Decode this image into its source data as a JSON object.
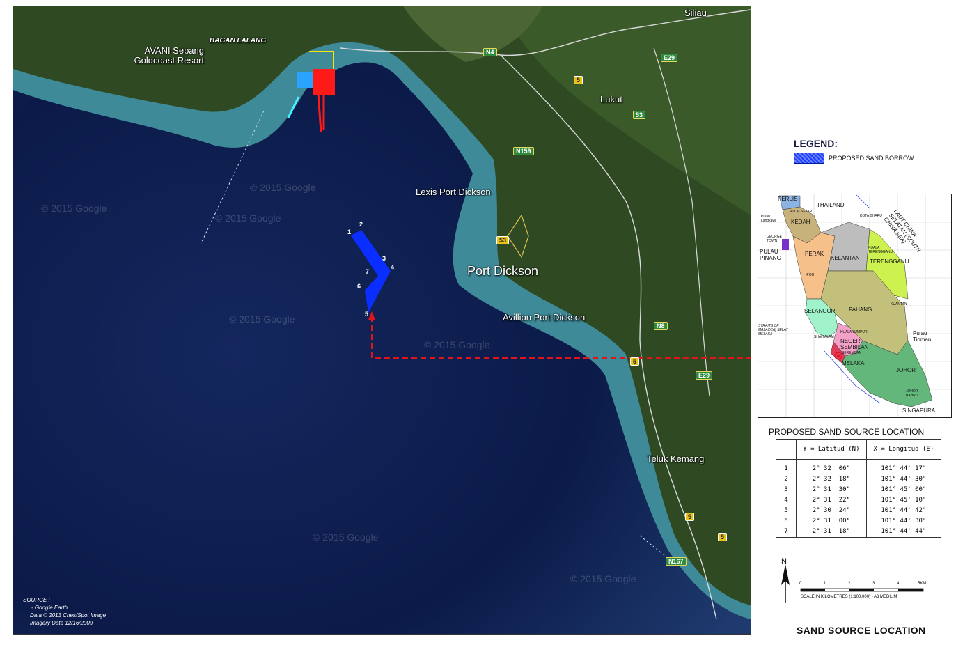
{
  "map": {
    "places": [
      {
        "name": "Siliau"
      },
      {
        "name": "BAGAN LALANG"
      },
      {
        "name": "AVANI Sepang Goldcoast Resort"
      },
      {
        "name": "Lukut"
      },
      {
        "name": "Lexis Port Dickson"
      },
      {
        "name": "Port Dickson"
      },
      {
        "name": "Avillion Port Dickson"
      },
      {
        "name": "Teluk Kemang"
      }
    ],
    "roads": [
      "N4",
      "E29",
      "5",
      "53",
      "N159",
      "53",
      "N8",
      "5",
      "E29",
      "5",
      "5",
      "N167"
    ],
    "watermark": "© 2015 Google",
    "sand_borrow_points": [
      "1",
      "2",
      "3",
      "4",
      "5",
      "6",
      "7"
    ],
    "colors": {
      "sand_borrow": "#0a2eff",
      "leader_line": "#e0151b",
      "sea_deep": "#0b1a48",
      "sea_shallow": "#3f8a98",
      "land": "#2f4a22"
    }
  },
  "source": {
    "heading": "SOURCE :",
    "line1": "- Google Earth",
    "line2": "Data © 2013 Cnes/Spot Image",
    "line3": "Imagery Date 12/16/2009"
  },
  "legend": {
    "title": "LEGEND:",
    "item": "PROPOSED SAND BORROW",
    "swatch_icon": "blue-hatch-swatch"
  },
  "inset": {
    "labels": {
      "perlis": "PERLIS",
      "thailand": "THAILAND",
      "alor_setar": "ALOR SETAR",
      "kota_bharu": "KOTA BHARU",
      "pulau_langkawi": "Pulau Langkawi",
      "kedah": "KEDAH",
      "laut": "LAUT CHINA SELATAN (SOUTH CHINA SEA)",
      "george_town": "GEORGE TOWN",
      "kuala_terengganu": "KUALA TERENGGANU",
      "pulau_pinang": "PULAU PINANG",
      "perak": "PERAK",
      "kelantan": "KELANTAN",
      "terengganu": "TERENGGANU",
      "ipoh": "IPOH",
      "kuantan": "KUANTAN",
      "selangor": "SELANGOR",
      "pahang": "PAHANG",
      "straits": "STRAITS OF MALACCA) SELAT MELAKA",
      "kuala_lumpur": "KUALA LUMPUR",
      "shah_alam": "SHAH ALAM",
      "negeri": "NEGERI SEMBILAN",
      "seremban": "SEREMBAN",
      "pulau_tioman": "Pulau Tioman",
      "melaka": "MELAKA",
      "johor": "JOHOR",
      "johor_bahru": "JOHOR BAHRU",
      "singapura": "SINGAPURA"
    },
    "colors": {
      "perlis": "#8db3e2",
      "kedah": "#c8b27c",
      "pulau_pinang": "#7a30c8",
      "perak": "#f6c08b",
      "kelantan": "#bdbdbd",
      "terengganu": "#cdf24f",
      "pahang": "#c2c07a",
      "selangor": "#9ff2ca",
      "negeri": "#f4a1c7",
      "melaka": "#e03b5a",
      "johor": "#64b77a"
    }
  },
  "coordinates": {
    "title": "PROPOSED SAND SOURCE LOCATION",
    "headers": [
      "",
      "Y = Latitud (N)",
      "X = Longitud (E)"
    ],
    "rows": [
      {
        "id": "1",
        "lat": "2°  32' 06\"",
        "lon": "101°  44' 17\""
      },
      {
        "id": "2",
        "lat": "2°  32' 18\"",
        "lon": "101°  44' 30\""
      },
      {
        "id": "3",
        "lat": "2°  31' 30\"",
        "lon": "101°  45' 00\""
      },
      {
        "id": "4",
        "lat": "2°  31' 22\"",
        "lon": "101°  45' 10\""
      },
      {
        "id": "5",
        "lat": "2°  30' 24\"",
        "lon": "101°  44' 42\""
      },
      {
        "id": "6",
        "lat": "2°  31' 00\"",
        "lon": "101°  44' 30\""
      },
      {
        "id": "7",
        "lat": "2°  31' 18\"",
        "lon": "101°  44' 44\""
      }
    ]
  },
  "scale": {
    "north": "N",
    "ticks": [
      "0",
      "1",
      "2",
      "3",
      "4",
      "5KM"
    ],
    "caption": "SCALE IN KILOMETRES (1:100,000) - A3 MEDIUM"
  },
  "page_title": "SAND SOURCE LOCATION"
}
